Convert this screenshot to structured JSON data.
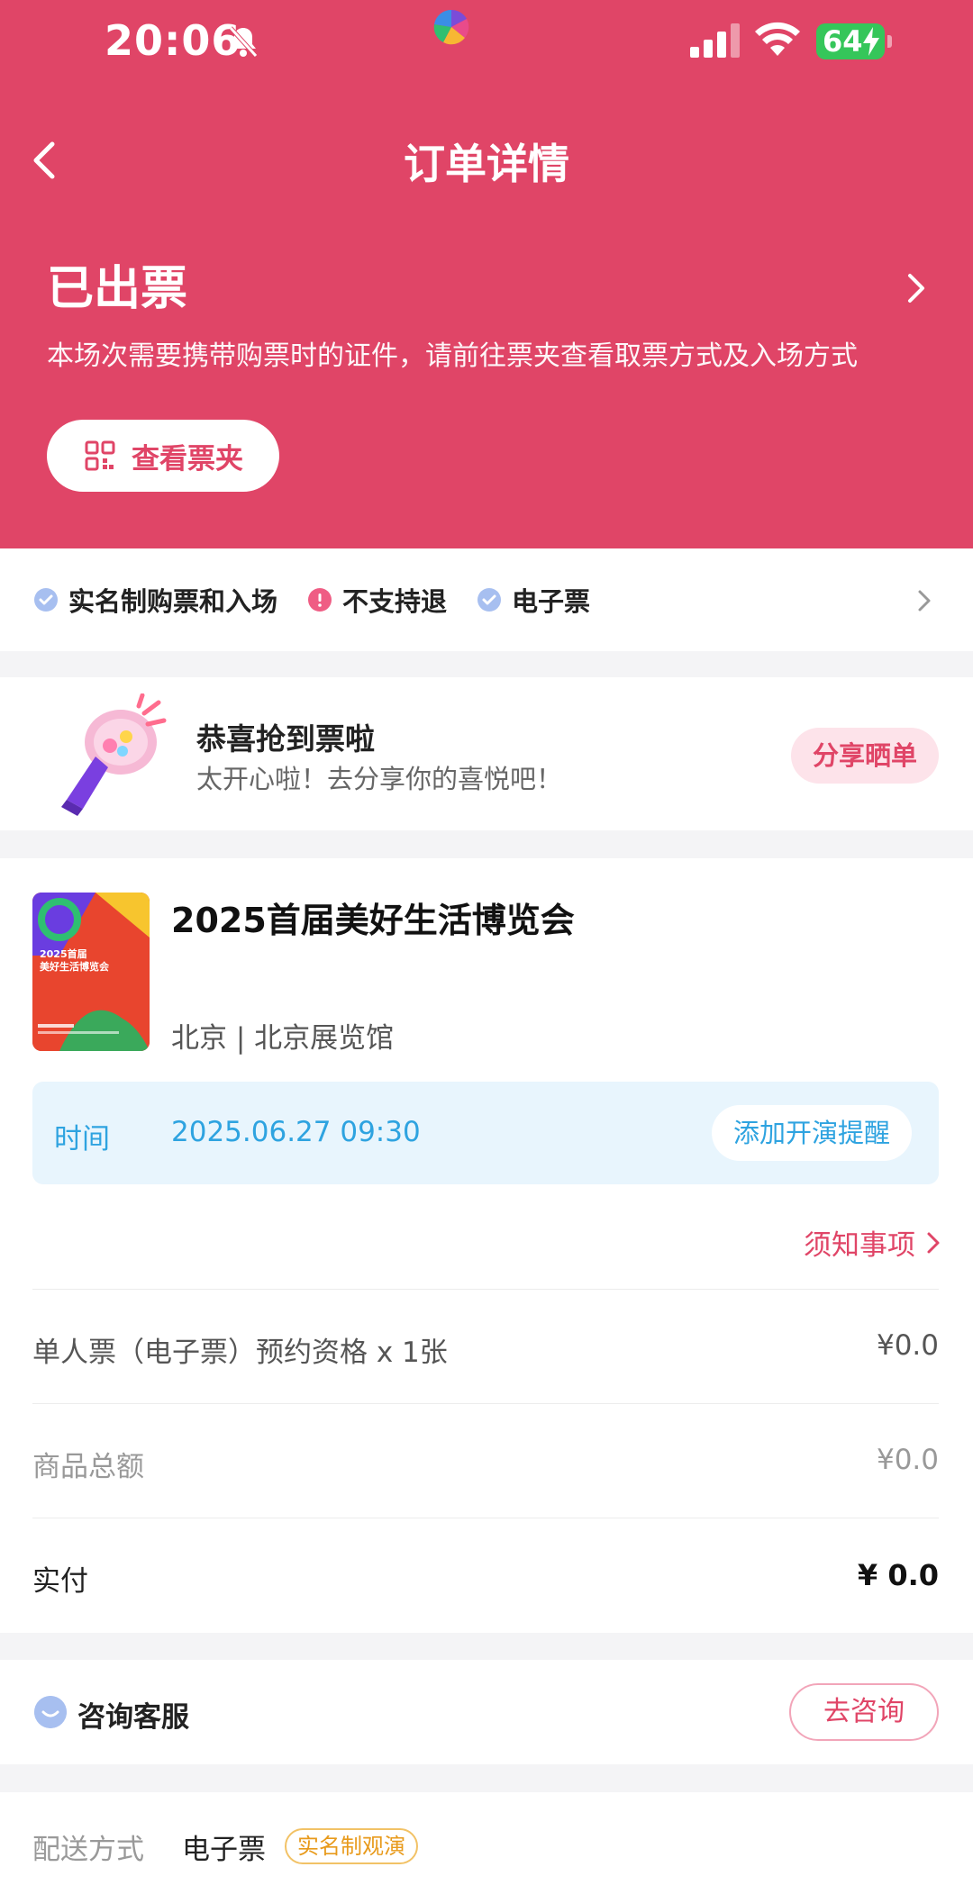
{
  "status_bar": {
    "time": "20:06",
    "battery": "64"
  },
  "nav": {
    "title": "订单详情"
  },
  "order_status": {
    "title": "已出票",
    "description": "本场次需要携带购票时的证件，请前往票夹查看取票方式及入场方式",
    "ticket_button": "查看票夹"
  },
  "tags": [
    {
      "label": "实名制购票和入场",
      "kind": "ok"
    },
    {
      "label": "不支持退",
      "kind": "warn"
    },
    {
      "label": "电子票",
      "kind": "ok"
    }
  ],
  "congrats": {
    "title": "恭喜抢到票啦",
    "subtitle": "太开心啦！去分享你的喜悦吧！",
    "share_button": "分享晒单"
  },
  "event": {
    "title": "2025首届美好生活博览会",
    "venue": "北京 | 北京展览馆",
    "poster_text": "2025首届 美好生活博览会",
    "time_label": "时间",
    "time_value": "2025.06.27 09:30",
    "remind_button": "添加开演提醒",
    "notice_link": "须知事项"
  },
  "price_rows": {
    "item": {
      "label": "单人票（电子票）预约资格 x 1张",
      "value": "¥0.0"
    },
    "subtotal": {
      "label": "商品总额",
      "value": "¥0.0"
    },
    "paid": {
      "label": "实付",
      "value": "¥ 0.0"
    }
  },
  "service": {
    "label": "咨询客服",
    "button": "去咨询"
  },
  "delivery": {
    "label": "配送方式",
    "value": "电子票",
    "badge": "实名制观演"
  },
  "colors": {
    "brand": "#e04567",
    "info": "#2ea3e0",
    "accent_warn": "#e89a1b"
  }
}
